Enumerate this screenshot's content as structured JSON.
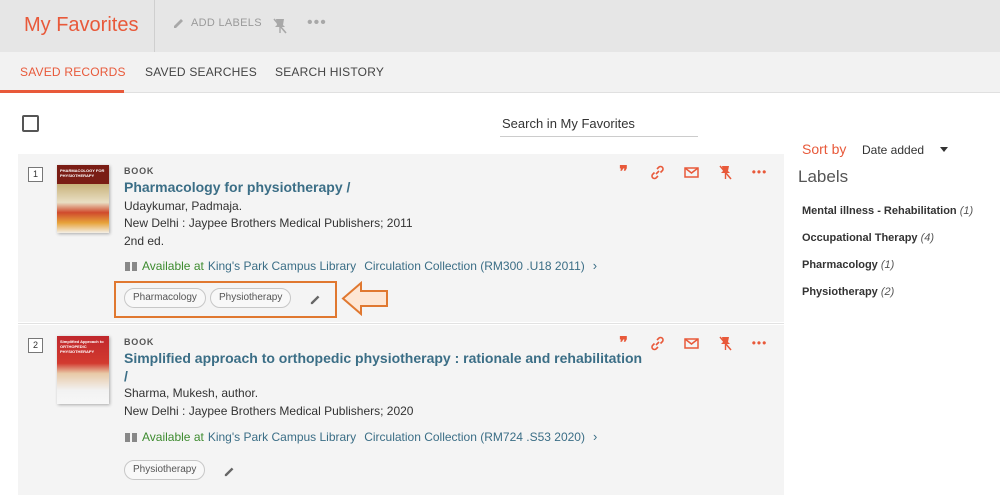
{
  "header": {
    "title": "My Favorites",
    "add_labels": "ADD LABELS"
  },
  "tabs": [
    {
      "label": "SAVED RECORDS",
      "active": true
    },
    {
      "label": "SAVED SEARCHES",
      "active": false
    },
    {
      "label": "SEARCH HISTORY",
      "active": false
    }
  ],
  "search": {
    "placeholder": "Search in My Favorites"
  },
  "records": [
    {
      "number": "1",
      "type": "BOOK",
      "title": "Pharmacology for physiotherapy /",
      "author": "Udaykumar, Padmaja.",
      "publisher": "New Delhi : Jaypee Brothers Medical Publishers; 2011",
      "edition": "2nd ed.",
      "availability": "Available at",
      "library": "King's Park Campus Library",
      "location": "Circulation Collection (RM300 .U18 2011)",
      "labels": [
        "Pharmacology",
        "Physiotherapy"
      ],
      "cover_text": "PHARMACOLOGY FOR PHYSIOTHERAPY"
    },
    {
      "number": "2",
      "type": "BOOK",
      "title": "Simplified approach to orthopedic physiotherapy : rationale and rehabilitation /",
      "author": "Sharma, Mukesh, author.",
      "publisher": "New Delhi : Jaypee Brothers Medical Publishers; 2020",
      "availability": "Available at",
      "library": "King's Park Campus Library",
      "location": "Circulation Collection (RM724 .S53 2020)",
      "labels": [
        "Physiotherapy"
      ],
      "cover_text": "Simplified Approach to ORTHOPEDIC PHYSIOTHERAPY"
    }
  ],
  "sort": {
    "label": "Sort by",
    "value": "Date added"
  },
  "labels_panel": {
    "title": "Labels",
    "items": [
      {
        "name": "Mental illness - Rehabilitation",
        "count": "(1)"
      },
      {
        "name": "Occupational Therapy",
        "count": "(4)"
      },
      {
        "name": "Pharmacology",
        "count": "(1)"
      },
      {
        "name": "Physiotherapy",
        "count": "(2)"
      }
    ]
  },
  "colors": {
    "accent": "#e8593a",
    "link": "#3b6e86",
    "available": "#3d8b2f",
    "highlight": "#e07830"
  }
}
